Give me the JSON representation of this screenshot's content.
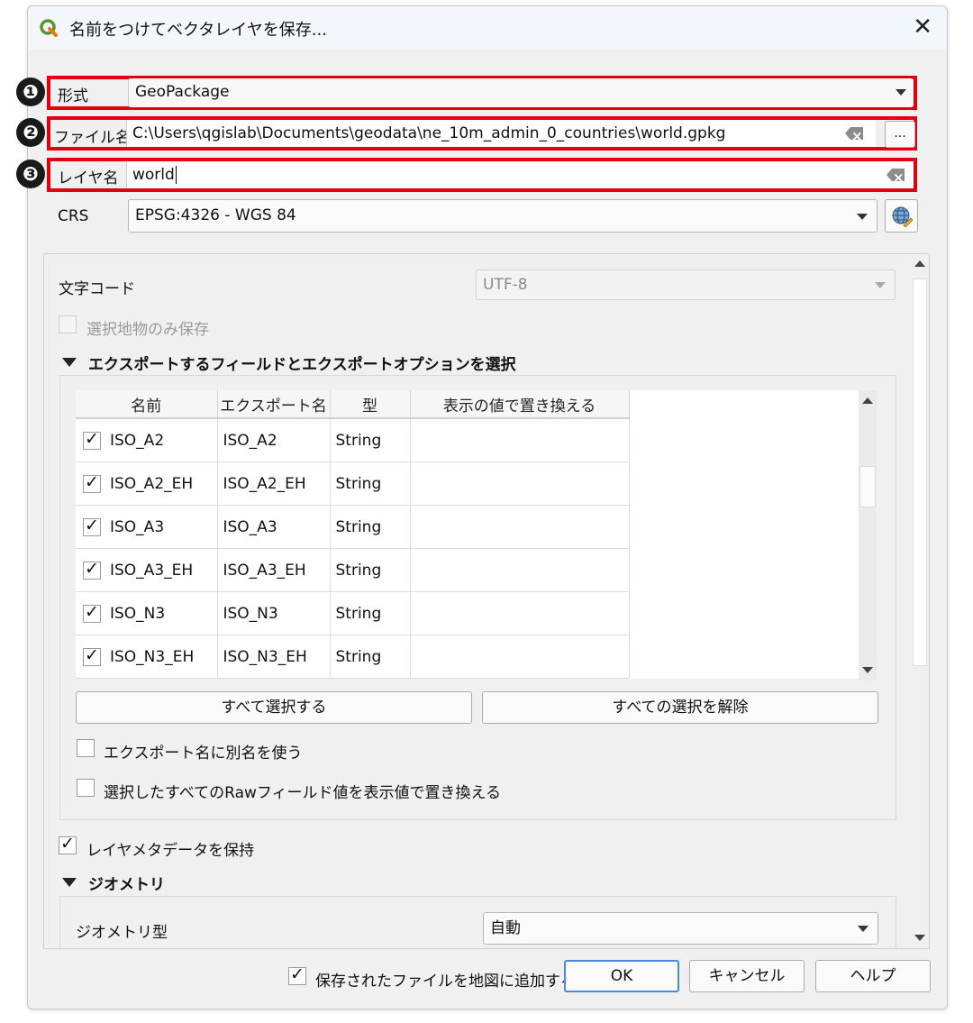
{
  "window": {
    "title": "名前をつけてベクタレイヤを保存..."
  },
  "badges": [
    "❶",
    "❷",
    "❸"
  ],
  "format": {
    "label": "形式",
    "value": "GeoPackage"
  },
  "filename": {
    "label": "ファイル名",
    "value": "C:\\Users\\qgislab\\Documents\\geodata\\ne_10m_admin_0_countries\\world.gpkg",
    "browse": "..."
  },
  "layername": {
    "label": "レイヤ名",
    "value": "world"
  },
  "crs": {
    "label": "CRS",
    "value": "EPSG:4326 - WGS 84"
  },
  "encoding": {
    "label": "文字コード",
    "value": "UTF-8"
  },
  "selected_only": {
    "label": "選択地物のみ保存",
    "checked": false
  },
  "fields_section": {
    "title": "エクスポートするフィールドとエクスポートオプションを選択",
    "headers": [
      "名前",
      "エクスポート名",
      "型",
      "表示の値で置き換える"
    ],
    "rows": [
      {
        "name": "ISO_A2",
        "export": "ISO_A2",
        "type": "String",
        "checked": true
      },
      {
        "name": "ISO_A2_EH",
        "export": "ISO_A2_EH",
        "type": "String",
        "checked": true
      },
      {
        "name": "ISO_A3",
        "export": "ISO_A3",
        "type": "String",
        "checked": true
      },
      {
        "name": "ISO_A3_EH",
        "export": "ISO_A3_EH",
        "type": "String",
        "checked": true
      },
      {
        "name": "ISO_N3",
        "export": "ISO_N3",
        "type": "String",
        "checked": true
      },
      {
        "name": "ISO_N3_EH",
        "export": "ISO_N3_EH",
        "type": "String",
        "checked": true
      }
    ],
    "select_all": "すべて選択する",
    "deselect_all": "すべての選択を解除",
    "use_alias": "エクスポート名に別名を使う",
    "replace_raw": "選択したすべてのRawフィールド値を表示値で置き換える"
  },
  "keep_metadata": {
    "label": "レイヤメタデータを保持",
    "checked": true
  },
  "geometry": {
    "title": "ジオメトリ",
    "type_label": "ジオメトリ型",
    "type_value": "自動"
  },
  "footer": {
    "add_to_map": "保存されたファイルを地図に追加する",
    "ok": "OK",
    "cancel": "キャンセル",
    "help": "ヘルプ"
  },
  "colors": {
    "highlight": "#e00010",
    "badge": "#1a1a1a"
  }
}
